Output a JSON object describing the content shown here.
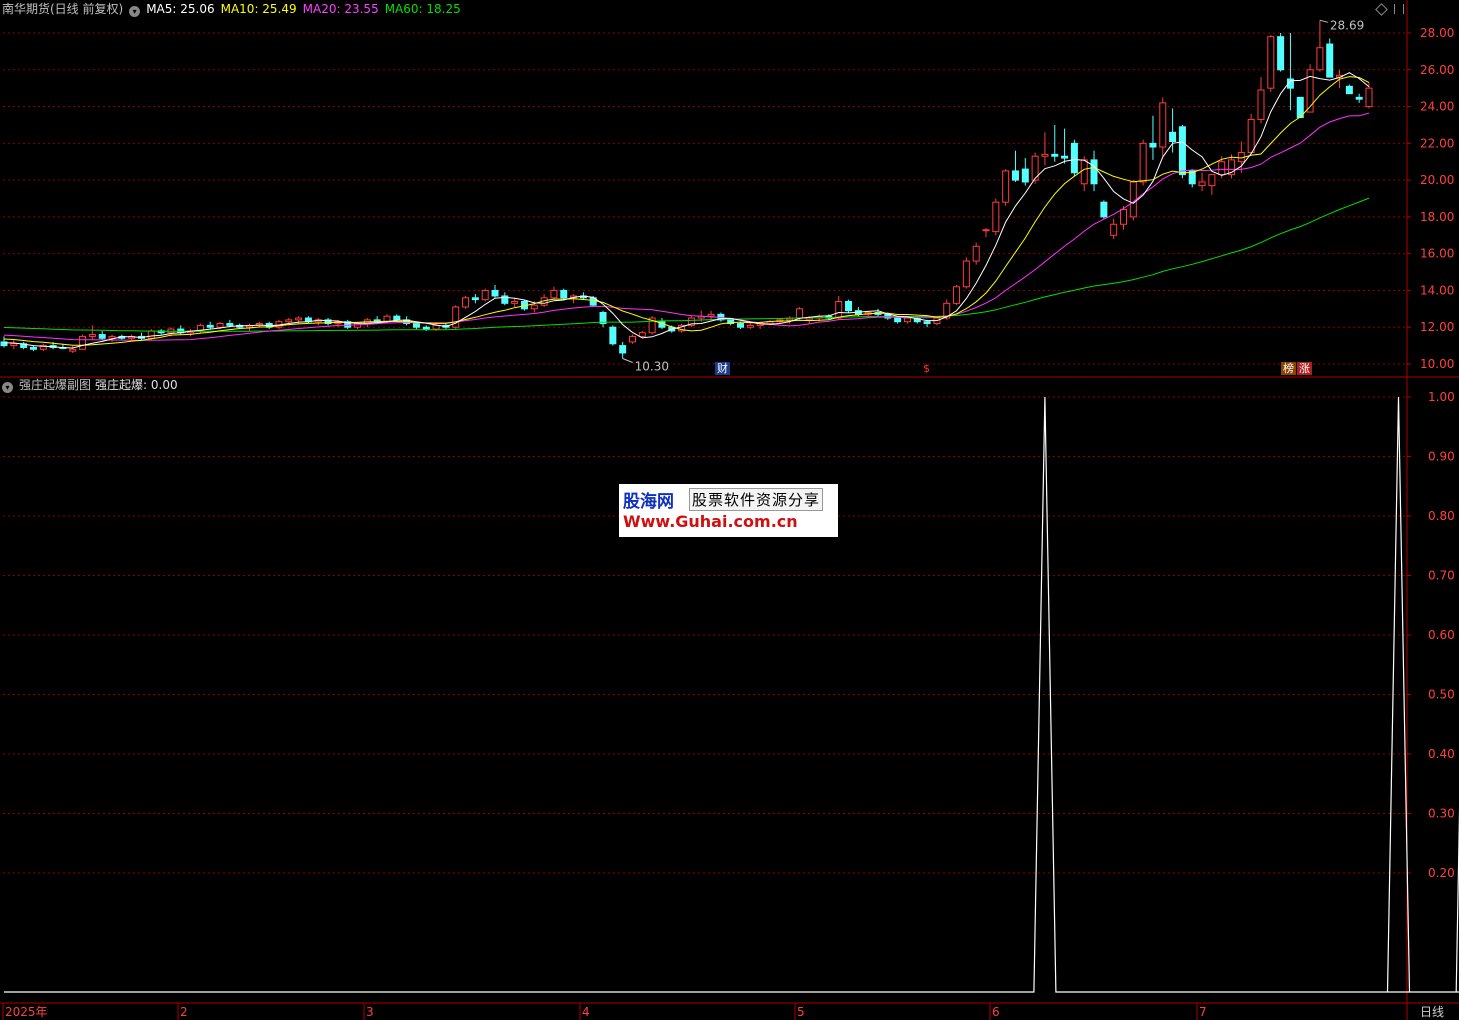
{
  "main_header": {
    "title": "南华期货(日线 前复权)",
    "ma5": "MA5: 25.06",
    "ma10": "MA10: 25.49",
    "ma20": "MA20: 23.55",
    "ma60": "MA60: 18.25"
  },
  "sub_header": {
    "title": "强庄起爆副图",
    "value": "强庄起爆: 0.00"
  },
  "flags": {
    "cai": "财",
    "dollar": "$",
    "bang": "榜",
    "zhang": "涨"
  },
  "period_label": "日线",
  "watermark": {
    "line1": "股海网",
    "line1b": "股票软件资源分享",
    "line2": "Www.Guhai.com.cn"
  },
  "colors": {
    "up": "#ff3b3b",
    "down": "#54ffff",
    "ma5": "#ffffff",
    "ma10": "#ffff00",
    "ma20": "#ff30ff",
    "ma60": "#00e000",
    "grid": "#8b0000",
    "axis_text": "#ff4040"
  },
  "chart_data": [
    {
      "type": "candlestick",
      "title": "南华期货(日线 前复权)",
      "y_ticks": [
        10.0,
        12.0,
        14.0,
        16.0,
        18.0,
        20.0,
        22.0,
        24.0,
        26.0,
        28.0
      ],
      "ylim": [
        9.6,
        29.2
      ],
      "x_labels": [
        "2025年",
        "2",
        "3",
        "4",
        "5",
        "6",
        "7"
      ],
      "annotations": [
        {
          "text": "28.69",
          "type": "high"
        },
        {
          "text": "10.30",
          "type": "low"
        }
      ],
      "ohlc": [
        [
          11.2,
          11.5,
          10.9,
          11.0
        ],
        [
          11.0,
          11.3,
          10.8,
          11.1
        ],
        [
          11.1,
          11.2,
          10.8,
          10.9
        ],
        [
          10.9,
          11.0,
          10.7,
          10.8
        ],
        [
          10.8,
          11.1,
          10.7,
          11.0
        ],
        [
          11.0,
          11.2,
          10.8,
          10.9
        ],
        [
          10.9,
          11.1,
          10.8,
          10.85
        ],
        [
          10.7,
          11.0,
          10.6,
          10.8
        ],
        [
          10.8,
          11.6,
          10.8,
          11.5
        ],
        [
          11.5,
          12.1,
          11.3,
          11.6
        ],
        [
          11.6,
          11.8,
          11.3,
          11.4
        ],
        [
          11.4,
          11.6,
          11.2,
          11.5
        ],
        [
          11.5,
          11.6,
          11.3,
          11.4
        ],
        [
          11.4,
          11.6,
          11.3,
          11.5
        ],
        [
          11.5,
          11.7,
          11.3,
          11.4
        ],
        [
          11.4,
          11.9,
          11.3,
          11.8
        ],
        [
          11.8,
          11.9,
          11.6,
          11.7
        ],
        [
          11.7,
          12.0,
          11.5,
          11.9
        ],
        [
          11.9,
          12.1,
          11.6,
          11.7
        ],
        [
          11.7,
          11.9,
          11.5,
          11.8
        ],
        [
          11.8,
          12.2,
          11.7,
          12.1
        ],
        [
          12.1,
          12.3,
          11.9,
          12.0
        ],
        [
          12.0,
          12.3,
          11.9,
          12.2
        ],
        [
          12.2,
          12.4,
          12.0,
          12.1
        ],
        [
          12.1,
          12.2,
          11.9,
          12.0
        ],
        [
          12.0,
          12.2,
          11.8,
          12.1
        ],
        [
          12.1,
          12.3,
          12.0,
          12.2
        ],
        [
          12.2,
          12.3,
          11.9,
          12.0
        ],
        [
          12.0,
          12.4,
          11.9,
          12.3
        ],
        [
          12.3,
          12.5,
          12.1,
          12.4
        ],
        [
          12.4,
          12.6,
          12.2,
          12.5
        ],
        [
          12.5,
          12.6,
          12.2,
          12.3
        ],
        [
          12.3,
          12.5,
          12.1,
          12.4
        ],
        [
          12.4,
          12.5,
          12.1,
          12.2
        ],
        [
          12.2,
          12.4,
          12.0,
          12.3
        ],
        [
          12.3,
          12.4,
          11.9,
          12.0
        ],
        [
          12.0,
          12.3,
          11.9,
          12.2
        ],
        [
          12.2,
          12.5,
          12.0,
          12.4
        ],
        [
          12.4,
          12.6,
          12.2,
          12.3
        ],
        [
          12.3,
          12.7,
          12.2,
          12.6
        ],
        [
          12.6,
          12.7,
          12.3,
          12.4
        ],
        [
          12.4,
          12.6,
          12.1,
          12.2
        ],
        [
          12.2,
          12.3,
          11.9,
          12.0
        ],
        [
          12.0,
          12.1,
          11.8,
          11.9
        ],
        [
          11.9,
          12.2,
          11.8,
          12.1
        ],
        [
          12.1,
          12.2,
          11.9,
          12.0
        ],
        [
          12.0,
          13.2,
          11.9,
          13.1
        ],
        [
          13.1,
          13.7,
          13.0,
          13.6
        ],
        [
          13.6,
          13.8,
          13.3,
          13.5
        ],
        [
          13.5,
          14.1,
          13.4,
          14.0
        ],
        [
          14.0,
          14.3,
          13.6,
          13.7
        ],
        [
          13.7,
          13.9,
          13.2,
          13.3
        ],
        [
          13.3,
          13.6,
          13.1,
          13.4
        ],
        [
          13.4,
          13.5,
          12.9,
          13.0
        ],
        [
          13.0,
          13.4,
          12.8,
          13.2
        ],
        [
          13.2,
          13.8,
          13.1,
          13.6
        ],
        [
          13.6,
          14.2,
          13.5,
          14.0
        ],
        [
          14.0,
          14.1,
          13.5,
          13.6
        ],
        [
          13.6,
          13.8,
          13.3,
          13.7
        ],
        [
          13.7,
          13.9,
          13.5,
          13.6
        ],
        [
          13.6,
          13.7,
          13.1,
          13.2
        ],
        [
          12.8,
          12.9,
          12.0,
          12.2
        ],
        [
          12.0,
          12.1,
          11.0,
          11.1
        ],
        [
          11.0,
          11.2,
          10.3,
          10.6
        ],
        [
          11.2,
          11.6,
          11.1,
          11.5
        ],
        [
          11.5,
          11.8,
          11.4,
          11.7
        ],
        [
          11.7,
          12.6,
          11.6,
          12.5
        ],
        [
          12.3,
          12.5,
          11.9,
          12.0
        ],
        [
          12.0,
          12.1,
          11.7,
          11.8
        ],
        [
          11.8,
          12.2,
          11.7,
          12.1
        ],
        [
          12.1,
          12.6,
          12.0,
          12.5
        ],
        [
          12.5,
          12.9,
          12.3,
          12.6
        ],
        [
          12.6,
          12.9,
          12.4,
          12.7
        ],
        [
          12.7,
          12.8,
          12.3,
          12.4
        ],
        [
          12.4,
          12.5,
          12.1,
          12.2
        ],
        [
          12.2,
          12.3,
          11.9,
          12.0
        ],
        [
          12.0,
          12.2,
          11.9,
          12.1
        ],
        [
          12.1,
          12.3,
          11.9,
          12.2
        ],
        [
          12.2,
          12.4,
          12.1,
          12.3
        ],
        [
          12.3,
          12.5,
          12.2,
          12.4
        ],
        [
          12.4,
          12.6,
          12.2,
          12.5
        ],
        [
          12.5,
          13.1,
          12.4,
          13.0
        ],
        [
          12.4,
          12.6,
          12.2,
          12.5
        ],
        [
          12.5,
          12.7,
          12.3,
          12.6
        ],
        [
          12.6,
          12.7,
          12.4,
          12.5
        ],
        [
          12.5,
          13.7,
          12.4,
          13.4
        ],
        [
          13.4,
          13.5,
          12.8,
          12.9
        ],
        [
          12.9,
          13.1,
          12.6,
          12.7
        ],
        [
          12.7,
          12.9,
          12.5,
          12.8
        ],
        [
          12.8,
          13.0,
          12.6,
          12.7
        ],
        [
          12.7,
          12.8,
          12.4,
          12.5
        ],
        [
          12.5,
          12.6,
          12.2,
          12.3
        ],
        [
          12.3,
          12.6,
          12.2,
          12.5
        ],
        [
          12.5,
          12.6,
          12.2,
          12.3
        ],
        [
          12.3,
          12.4,
          12.0,
          12.2
        ],
        [
          12.2,
          12.6,
          12.1,
          12.5
        ],
        [
          12.5,
          13.5,
          12.4,
          13.3
        ],
        [
          13.3,
          14.3,
          13.2,
          14.2
        ],
        [
          14.2,
          15.8,
          14.1,
          15.6
        ],
        [
          15.6,
          16.6,
          15.4,
          16.4
        ],
        [
          17.3,
          17.4,
          16.9,
          17.3
        ],
        [
          17.2,
          19.0,
          17.0,
          18.8
        ],
        [
          18.8,
          20.6,
          18.6,
          20.5
        ],
        [
          20.5,
          21.6,
          19.9,
          20.0
        ],
        [
          20.6,
          21.2,
          19.7,
          19.9
        ],
        [
          20.0,
          21.5,
          19.8,
          21.3
        ],
        [
          21.3,
          22.6,
          20.8,
          21.4
        ],
        [
          21.4,
          23.0,
          21.0,
          21.3
        ],
        [
          21.3,
          22.8,
          20.9,
          21.2
        ],
        [
          22.0,
          22.2,
          20.2,
          20.4
        ],
        [
          19.8,
          21.3,
          19.4,
          21.1
        ],
        [
          21.1,
          21.6,
          19.4,
          19.8
        ],
        [
          18.8,
          18.9,
          17.9,
          18.0
        ],
        [
          17.0,
          17.9,
          16.8,
          17.6
        ],
        [
          17.6,
          18.6,
          17.3,
          18.4
        ],
        [
          18.0,
          20.0,
          17.8,
          19.9
        ],
        [
          19.9,
          22.2,
          19.7,
          22.0
        ],
        [
          22.0,
          23.5,
          21.1,
          21.8
        ],
        [
          21.8,
          24.5,
          21.3,
          24.2
        ],
        [
          22.6,
          23.9,
          21.5,
          22.1
        ],
        [
          22.9,
          23.0,
          20.1,
          20.3
        ],
        [
          20.5,
          20.6,
          19.6,
          19.8
        ],
        [
          19.7,
          20.4,
          19.4,
          19.9
        ],
        [
          19.7,
          20.3,
          19.2,
          20.3
        ],
        [
          20.3,
          21.3,
          20.1,
          21.0
        ],
        [
          20.3,
          21.4,
          20.1,
          21.1
        ],
        [
          21.0,
          22.1,
          20.4,
          21.5
        ],
        [
          21.5,
          23.6,
          21.4,
          23.3
        ],
        [
          23.3,
          25.6,
          23.1,
          24.9
        ],
        [
          25.0,
          27.9,
          24.8,
          27.8
        ],
        [
          27.8,
          28.0,
          25.9,
          26.0
        ],
        [
          25.5,
          28.0,
          23.8,
          25.0
        ],
        [
          24.5,
          24.5,
          23.6,
          23.4
        ],
        [
          23.7,
          26.3,
          23.7,
          26.0
        ],
        [
          26.0,
          28.69,
          25.9,
          27.2
        ],
        [
          27.4,
          27.7,
          25.7,
          25.6
        ],
        [
          25.6,
          26.0,
          25.0,
          25.7
        ],
        [
          25.1,
          25.2,
          24.8,
          24.7
        ],
        [
          24.5,
          24.7,
          24.2,
          24.4
        ],
        [
          24.0,
          25.3,
          23.9,
          25.0
        ]
      ]
    },
    {
      "type": "line",
      "title": "强庄起爆副图",
      "series": [
        {
          "name": "强庄起爆",
          "values_note_indexes": [
            106,
            142,
            149
          ]
        }
      ],
      "y_ticks": [
        0.2,
        0.3,
        0.4,
        0.5,
        0.6,
        0.7,
        0.8,
        0.9,
        1.0
      ],
      "ylim": [
        0,
        1.0
      ],
      "spikes_at_index": [
        106,
        142,
        149
      ]
    }
  ]
}
